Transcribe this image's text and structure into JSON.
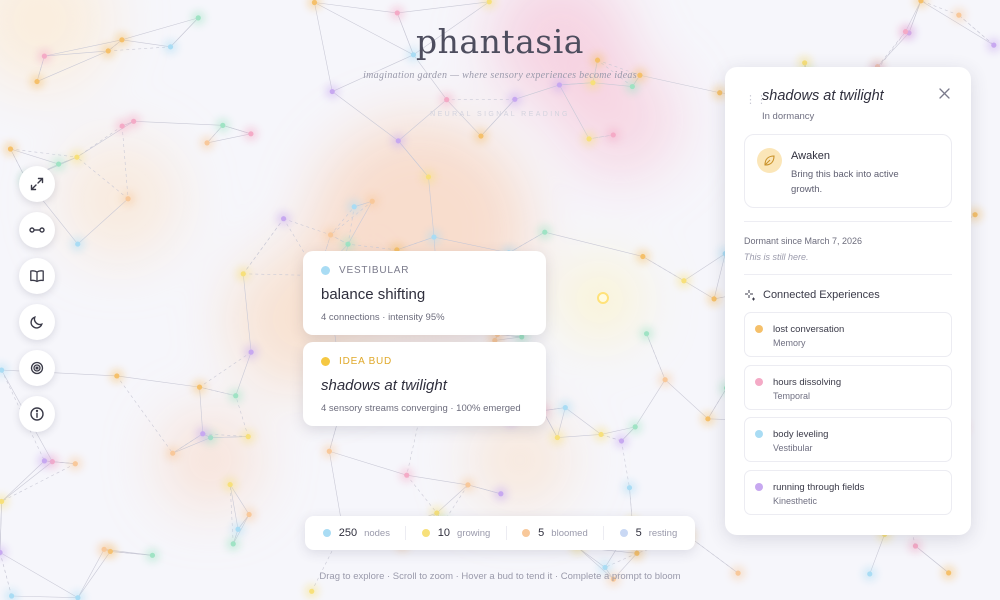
{
  "header": {
    "title": "phantasia",
    "subtitle": "imagination garden — where sensory experiences become ideas",
    "reading_label": "NEURAL SIGNAL READING"
  },
  "toolbar": {
    "items": [
      {
        "name": "expand-icon"
      },
      {
        "name": "link-icon"
      },
      {
        "name": "book-icon"
      },
      {
        "name": "moon-icon"
      },
      {
        "name": "target-icon"
      },
      {
        "name": "info-icon"
      }
    ]
  },
  "hover_cards": [
    {
      "category": "VESTIBULAR",
      "category_color": "#a9dcf4",
      "title": "balance shifting",
      "meta": "4 connections · intensity 95%"
    },
    {
      "category": "IDEA BUD",
      "category_color": "#f5c842",
      "title": "shadows at twilight",
      "meta": "4 sensory streams converging · 100% emerged"
    }
  ],
  "panel": {
    "title": "shadows at twilight",
    "status": "In dormancy",
    "action": {
      "label": "Awaken",
      "description": "Bring this back into active growth.",
      "icon": "leaf-icon"
    },
    "dormant_since": "Dormant since March 7, 2026",
    "note": "This is still here.",
    "connected_heading": "Connected Experiences",
    "connections": [
      {
        "name": "lost conversation",
        "type": "Memory",
        "color": "#f5c06a"
      },
      {
        "name": "hours dissolving",
        "type": "Temporal",
        "color": "#f4aac6"
      },
      {
        "name": "body leveling",
        "type": "Vestibular",
        "color": "#a9dcf4"
      },
      {
        "name": "running through fields",
        "type": "Kinesthetic",
        "color": "#c7a8f0"
      }
    ]
  },
  "stats": [
    {
      "value": "250",
      "label": "nodes",
      "color": "#a9dcf4"
    },
    {
      "value": "10",
      "label": "growing",
      "color": "#f7e07a"
    },
    {
      "value": "5",
      "label": "bloomed",
      "color": "#f8c89a"
    },
    {
      "value": "5",
      "label": "resting",
      "color": "#c9d8f4"
    }
  ],
  "footer_hint": "Drag to explore · Scroll to zoom · Hover a bud to tend it · Complete a prompt to bloom",
  "colors": {
    "background": "#f6f6fb",
    "node_palette": [
      "#f5c06a",
      "#a9dcf4",
      "#c7a8f0",
      "#9fe3c4",
      "#f4aac6",
      "#f8c89a",
      "#f7e07a"
    ]
  }
}
